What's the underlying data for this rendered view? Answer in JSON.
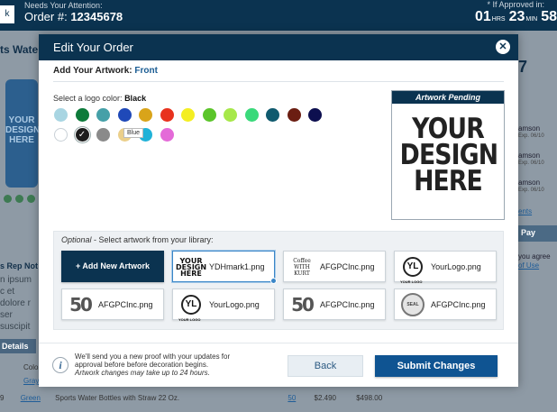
{
  "bg_page": {
    "back_label": "k",
    "attention_label": "Needs Your Attention:",
    "order_prefix": "Order #:",
    "order_number": "12345678",
    "approved_label": "* If Approved in:",
    "timer": {
      "hrs": "01",
      "hrs_unit": "HRS",
      "min": "23",
      "min_unit": "MIN",
      "sec": "58"
    },
    "product_title": "ts Wate",
    "bottle_text": "YOUR DESIGN HERE",
    "rep_notes_label": "s Rep Not",
    "lorem": "n ipsum c et dolore r ser suscipit",
    "details_label": "Details",
    "col_label": "Colo",
    "row1_color": "Gray",
    "row2_num": "9",
    "row2_color": "Green",
    "row2_desc": "Sports Water Bottles with Straw 22 Oz.",
    "row2_qty": "50",
    "row2_price": "$2.490",
    "row2_total": "$498.00",
    "right_number": "7",
    "right_names": [
      "amson",
      "amson",
      "amson"
    ],
    "right_dates": [
      "Exp. 06/10",
      "Exp. 06/10",
      "Exp. 06/10"
    ],
    "right_link": "ents",
    "pay_label": "Pay",
    "agree_text": "you agree",
    "terms_link": "of Use"
  },
  "modal": {
    "title": "Edit Your Order",
    "close_icon": "close-icon",
    "artwork_label": "Add Your Artwork:",
    "artwork_value": "Front",
    "logo_color_label": "Select a logo color:",
    "logo_color_value": "Black",
    "tooltip": "Blue",
    "swatches_row1": [
      "#a8d5e2",
      "#0d7a3a",
      "#45a0a8",
      "#1f49b8",
      "#d9a41a",
      "#e8321e",
      "#f4ee22",
      "#5bc52a",
      "#a7e84a",
      "#3ad97a",
      "#0f5a6e",
      "#6b1e12",
      "#0d0f4f"
    ],
    "swatches_row2": [
      "#ffffff",
      "#1c1c1c",
      "#8a8a8a",
      "#ebcf8a",
      "#20b2d8",
      "#e46ad8"
    ],
    "selected_check": "✓",
    "pending_label": "Artwork Pending",
    "pending_art": "YOUR DESIGN HERE",
    "library_optional": "Optional",
    "library_label": " - Select artwork from your library:",
    "add_artwork": "+ Add New Artwork",
    "files": [
      {
        "name": "YDHmark1.png",
        "thumb": "YOUR DESIGN HERE"
      },
      {
        "name": "AFGPCInc.png",
        "thumb": "Coffee WITH KURT"
      },
      {
        "name": "YourLogo.png",
        "thumb": "YL",
        "thumb_sub": "YOUR LOGO"
      },
      {
        "name": "AFGPCInc.png",
        "thumb": "50"
      },
      {
        "name": "YourLogo.png",
        "thumb": "YL",
        "thumb_sub": "YOUR LOGO"
      },
      {
        "name": "AFGPCInc.png",
        "thumb": "50"
      },
      {
        "name": "AFGPCInc.png",
        "thumb": "SEAL"
      }
    ],
    "info_icon": "i",
    "info_line1": "We'll send you a new proof with your updates for approval before before decoration begins.",
    "info_line2": "Artwork changes may take up to 24 hours.",
    "back_button": "Back",
    "submit_button": "Submit Changes"
  }
}
